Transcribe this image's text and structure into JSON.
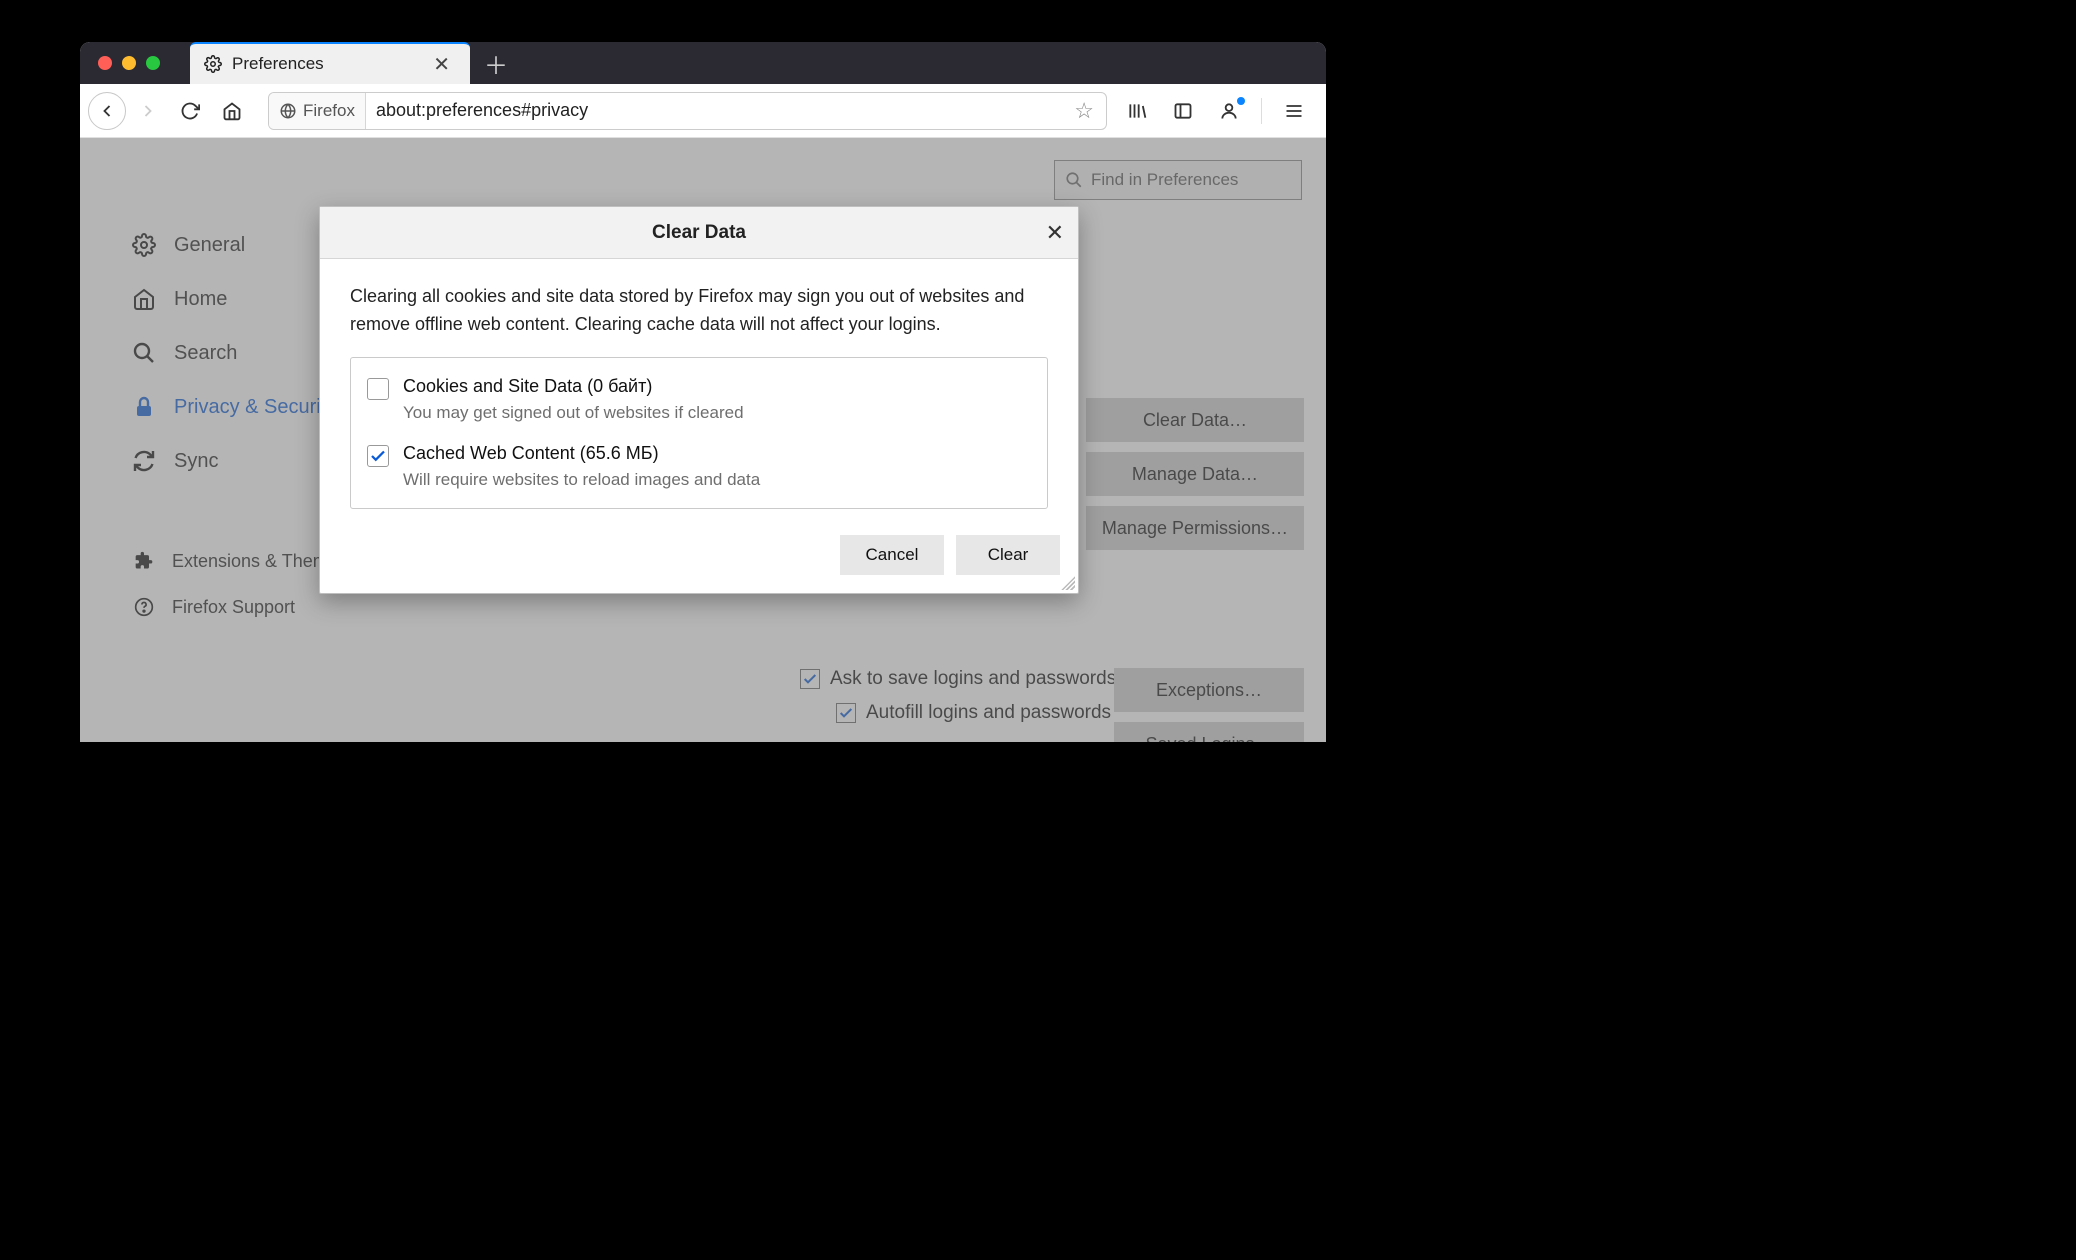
{
  "tab": {
    "title": "Preferences"
  },
  "addressbar": {
    "identity": "Firefox",
    "url": "about:preferences#privacy"
  },
  "search": {
    "placeholder": "Find in Preferences"
  },
  "sidebar": {
    "items": [
      {
        "label": "General"
      },
      {
        "label": "Home"
      },
      {
        "label": "Search"
      },
      {
        "label": "Privacy & Security"
      },
      {
        "label": "Sync"
      }
    ],
    "extras": [
      {
        "label": "Extensions & Themes"
      },
      {
        "label": "Firefox Support"
      }
    ]
  },
  "buttons_right": {
    "clear_data": "Clear Data…",
    "manage_data": "Manage Data…",
    "manage_permissions": "Manage Permissions…",
    "exceptions": "Exceptions…",
    "saved_logins": "Saved Logins…"
  },
  "logins": {
    "ask": "Ask to save logins and passwords for websites",
    "autofill": "Autofill logins and passwords"
  },
  "modal": {
    "title": "Clear Data",
    "description": "Clearing all cookies and site data stored by Firefox may sign you out of websites and remove offline web content. Clearing cache data will not affect your logins.",
    "options": [
      {
        "title": "Cookies and Site Data (0 байт)",
        "sub": "You may get signed out of websites if cleared",
        "checked": false
      },
      {
        "title": "Cached Web Content (65.6 МБ)",
        "sub": "Will require websites to reload images and data",
        "checked": true
      }
    ],
    "cancel": "Cancel",
    "clear": "Clear"
  }
}
